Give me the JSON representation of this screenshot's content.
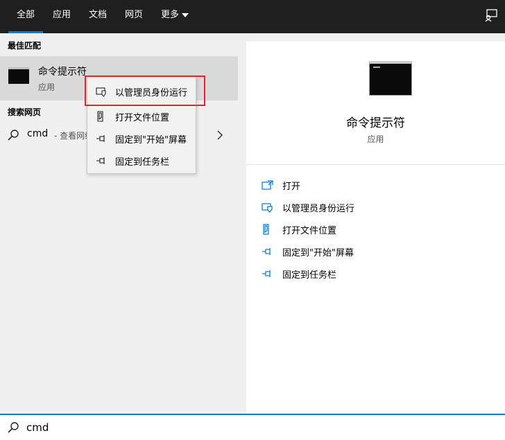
{
  "tabs": [
    {
      "label": "全部",
      "active": true
    },
    {
      "label": "应用"
    },
    {
      "label": "文档"
    },
    {
      "label": "网页"
    },
    {
      "label": "更多"
    }
  ],
  "left": {
    "best_match_title": "最佳匹配",
    "best_match": {
      "name": "命令提示符",
      "type": "应用"
    },
    "web_title": "搜索网页",
    "web": {
      "term": "cmd",
      "hint": "- 查看网络"
    }
  },
  "context_menu": [
    {
      "label": "以管理员身份运行",
      "icon": "shield-window-icon"
    },
    {
      "label": "打开文件位置",
      "icon": "file-location-icon"
    },
    {
      "label": "固定到\"开始\"屏幕",
      "icon": "pin-icon"
    },
    {
      "label": "固定到任务栏",
      "icon": "pin-icon"
    }
  ],
  "detail": {
    "title": "命令提示符",
    "subtitle": "应用",
    "actions": [
      {
        "label": "打开",
        "icon": "open-icon"
      },
      {
        "label": "以管理员身份运行",
        "icon": "shield-window-icon"
      },
      {
        "label": "打开文件位置",
        "icon": "file-location-icon"
      },
      {
        "label": "固定到\"开始\"屏幕",
        "icon": "pin-icon"
      },
      {
        "label": "固定到任务栏",
        "icon": "pin-icon"
      }
    ]
  },
  "search": {
    "value": "cmd"
  },
  "colors": {
    "accent": "#0078d7",
    "highlight_border": "#e0242b",
    "topbar": "#1f1f1f"
  }
}
